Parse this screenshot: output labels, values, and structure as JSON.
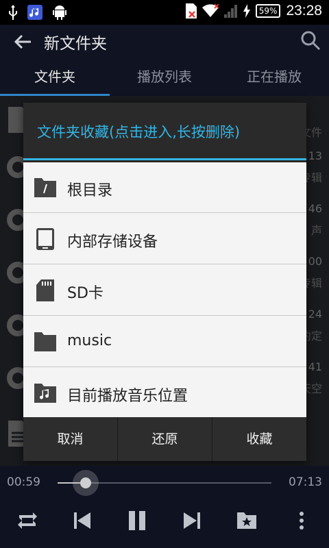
{
  "status_bar": {
    "time": "23:28",
    "battery": "59%"
  },
  "app_bar": {
    "title": "新文件夹"
  },
  "tabs": [
    {
      "label": "文件夹"
    },
    {
      "label": "播放列表"
    },
    {
      "label": "正在播放"
    }
  ],
  "background_list": {
    "rows": [
      {
        "time": "13",
        "sub": "专辑"
      },
      {
        "time": "46",
        "sub": "声"
      },
      {
        "time": "00",
        "sub": "专辑"
      },
      {
        "time": "24",
        "sub": "约定"
      },
      {
        "time": "41",
        "sub": "天空"
      }
    ],
    "top_right_text": "文件"
  },
  "dialog": {
    "title": "文件夹收藏(点击进入,长按删除)",
    "items": [
      {
        "label": "根目录",
        "icon": "root-folder-icon"
      },
      {
        "label": "内部存储设备",
        "icon": "phone-storage-icon"
      },
      {
        "label": "SD卡",
        "icon": "sd-card-icon"
      },
      {
        "label": "music",
        "icon": "folder-icon"
      },
      {
        "label": "目前播放音乐位置",
        "icon": "music-folder-icon"
      }
    ],
    "actions": {
      "cancel": "取消",
      "restore": "还原",
      "favorite": "收藏"
    },
    "accent_color": "#33b5e5"
  },
  "player": {
    "current_time": "00:59",
    "total_time": "07:13",
    "progress": 0.13
  }
}
